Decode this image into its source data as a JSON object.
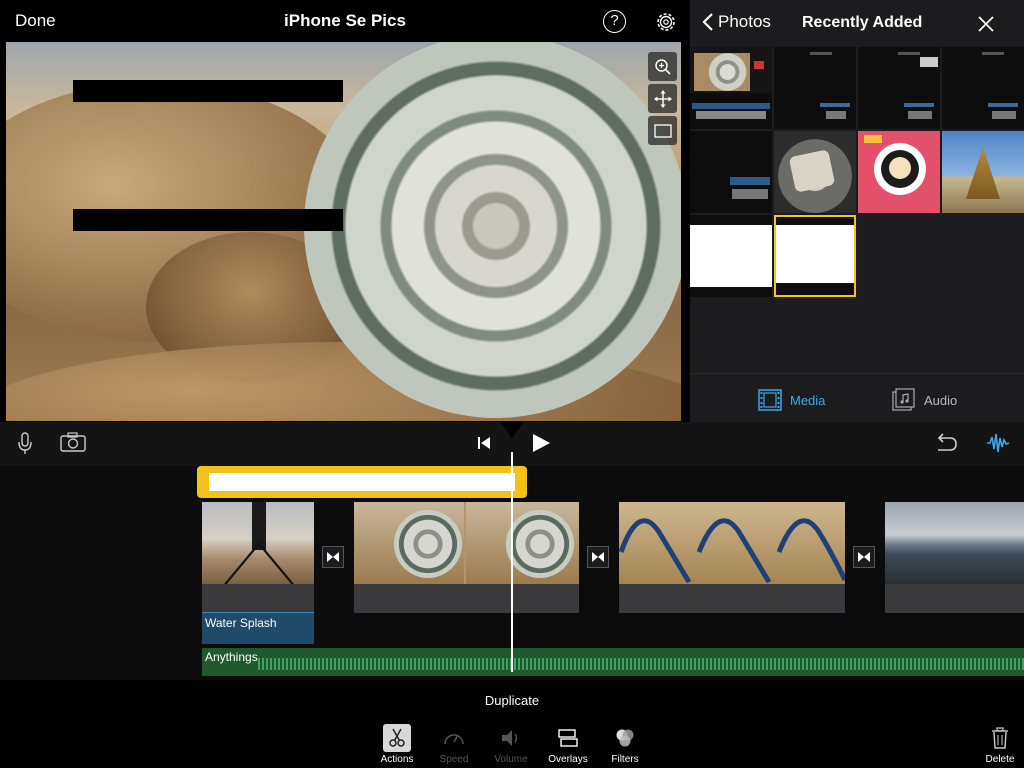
{
  "header": {
    "done_label": "Done",
    "project_title": "iPhone Se Pics",
    "help_label": "?"
  },
  "media_browser": {
    "back_label": "Photos",
    "title": "Recently Added",
    "tabs": [
      {
        "label": "Media",
        "active": true
      },
      {
        "label": "Audio",
        "active": false
      }
    ]
  },
  "timeline": {
    "audio_clip_label": "Water Splash",
    "music_label": "Anythings"
  },
  "toolbar": {
    "action_title": "Duplicate",
    "tools": [
      {
        "label": "Actions",
        "state": "active",
        "icon": "scissors-icon"
      },
      {
        "label": "Speed",
        "state": "disabled",
        "icon": "speedometer-icon"
      },
      {
        "label": "Volume",
        "state": "disabled",
        "icon": "speaker-icon"
      },
      {
        "label": "Overlays",
        "state": "enabled",
        "icon": "overlays-icon"
      },
      {
        "label": "Filters",
        "state": "enabled",
        "icon": "filters-icon"
      }
    ],
    "delete_label": "Delete"
  },
  "colors": {
    "accent_blue": "#3fa7e8",
    "selection_yellow": "#f5c518",
    "music_green": "#1f5a2e",
    "audio_blue": "#1f4b6a"
  }
}
